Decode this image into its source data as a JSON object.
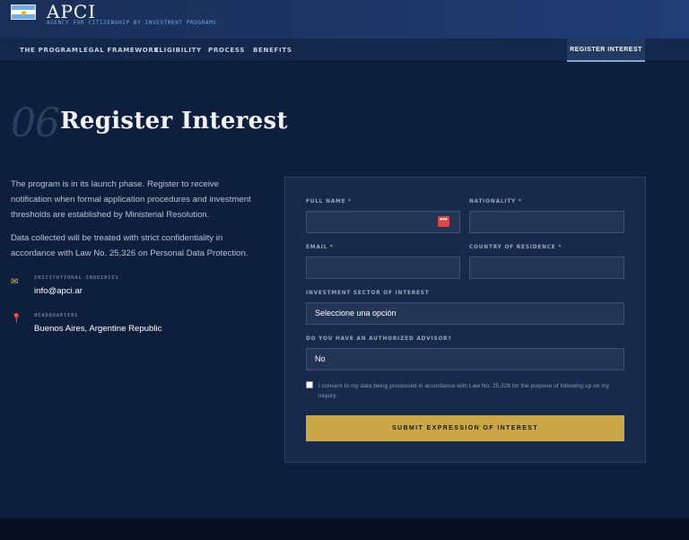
{
  "brand": {
    "name": "APCI",
    "tagline": "AGENCY FOR CITIZENSHIP BY INVESTMENT PROGRAMS"
  },
  "nav": {
    "items": [
      "THE PROGRAM",
      "LEGAL FRAMEWORK",
      "ELIGIBILITY",
      "PROCESS",
      "BENEFITS"
    ],
    "register": "REGISTER INTEREST"
  },
  "heading": {
    "number": "06",
    "title": "Register Interest"
  },
  "intro": {
    "paragraph1": "The program is in its launch phase. Register to receive notification when formal application procedures and investment thresholds are established by Ministerial Resolution.",
    "paragraph2": "Data collected will be treated with strict confidentiality in accordance with Law No. 25,326 on Personal Data Protection."
  },
  "contacts": [
    {
      "icon": "envelope-icon",
      "label": "INSTITUTIONAL INQUIRIES",
      "value": "info@apci.ar"
    },
    {
      "icon": "pushpin-icon",
      "label": "HEADQUARTERS",
      "value": "Buenos Aires, Argentine Republic"
    }
  ],
  "form": {
    "full_name_label": "FULL NAME *",
    "full_name_value": "",
    "nationality_label": "NATIONALITY *",
    "nationality_value": "",
    "email_label": "EMAIL *",
    "email_value": "",
    "country_label": "COUNTRY OF RESIDENCE *",
    "country_value": "",
    "sector_label": "INVESTMENT SECTOR OF INTEREST",
    "sector_value": "Seleccione una opción",
    "advisor_label": "DO YOU HAVE AN AUTHORIZED ADVISOR?",
    "advisor_value": "No",
    "consent_text": "I consent to my data being processed in accordance with Law No. 25,326 for the purpose of following up on my inquiry.",
    "submit_label": "SUBMIT EXPRESSION OF INTEREST",
    "password_badge": "•••"
  },
  "colors": {
    "background": "#0e1f3d",
    "accent_gold": "#c9a646",
    "header": "#1f3c74",
    "link_blue": "#6ba6e8"
  }
}
